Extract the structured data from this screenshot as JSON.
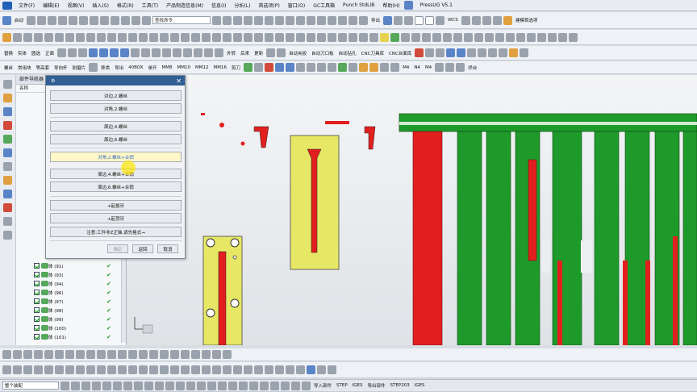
{
  "menubar": {
    "items": [
      "文件(F)",
      "编辑(E)",
      "视图(V)",
      "插入(S)",
      "格式(R)",
      "工具(T)",
      "产品制造信息(M)",
      "信息(I)",
      "分析(L)",
      "首选项(P)",
      "窗口(O)",
      "GC工具箱",
      "Punch StdLIB",
      "帮助(H)"
    ],
    "version": "PressUG V5.1"
  },
  "toolbar1": {
    "start_label": "启动",
    "command_find": "查找命令",
    "export_label": "导出",
    "wcs_label": "WCS",
    "build_label": "建模首选项"
  },
  "toolbar3": {
    "labels": [
      "替换",
      "实体",
      "圆选",
      "正面",
      "外转",
      "后来",
      "更新",
      "自动夹扳",
      "自动刀口板",
      "自动钻孔",
      "CNC刀具库",
      "CNC台面库"
    ]
  },
  "toolbar4": {
    "labels": [
      "螺丝",
      "常用块",
      "等高套",
      "导向杆",
      "耐磨片",
      "移类",
      "导出",
      "40BOX",
      "单开",
      "MM8",
      "MM10",
      "MM12",
      "MM16",
      "剪刀",
      "M4",
      "N4",
      "M4",
      "抒台"
    ]
  },
  "nav": {
    "title": "部件导航器",
    "column": "名称",
    "rows": [
      "体 (91)",
      "体 (93)",
      "体 (94)",
      "体 (96)",
      "体 (97)",
      "体 (98)",
      "体 (99)",
      "体 (100)",
      "体 (101)"
    ]
  },
  "dialog": {
    "buttons": [
      "对边,2.螺丝",
      "对角,2.螺丝",
      "周边,4.螺丝",
      "周边,6.螺丝",
      "对角,2.螺丝+合销",
      "周边,4.螺丝+合销",
      "周边,6.螺丝+合销",
      "+起拔牙",
      "+起顶牙",
      "注意:工件非Z正轴,请先格式→"
    ],
    "footer": {
      "ok": "确定",
      "back": "返回",
      "cancel": "取消"
    }
  },
  "status": {
    "filter": "整个装配",
    "right": [
      "导入部件",
      "STEP",
      "IGES",
      "导出部件",
      "STEP203",
      "IGES"
    ]
  },
  "colors": {
    "green": "#1e9a2a",
    "red": "#e21f1f",
    "yellow": "#e6e865",
    "accent": "#2f5f93"
  }
}
